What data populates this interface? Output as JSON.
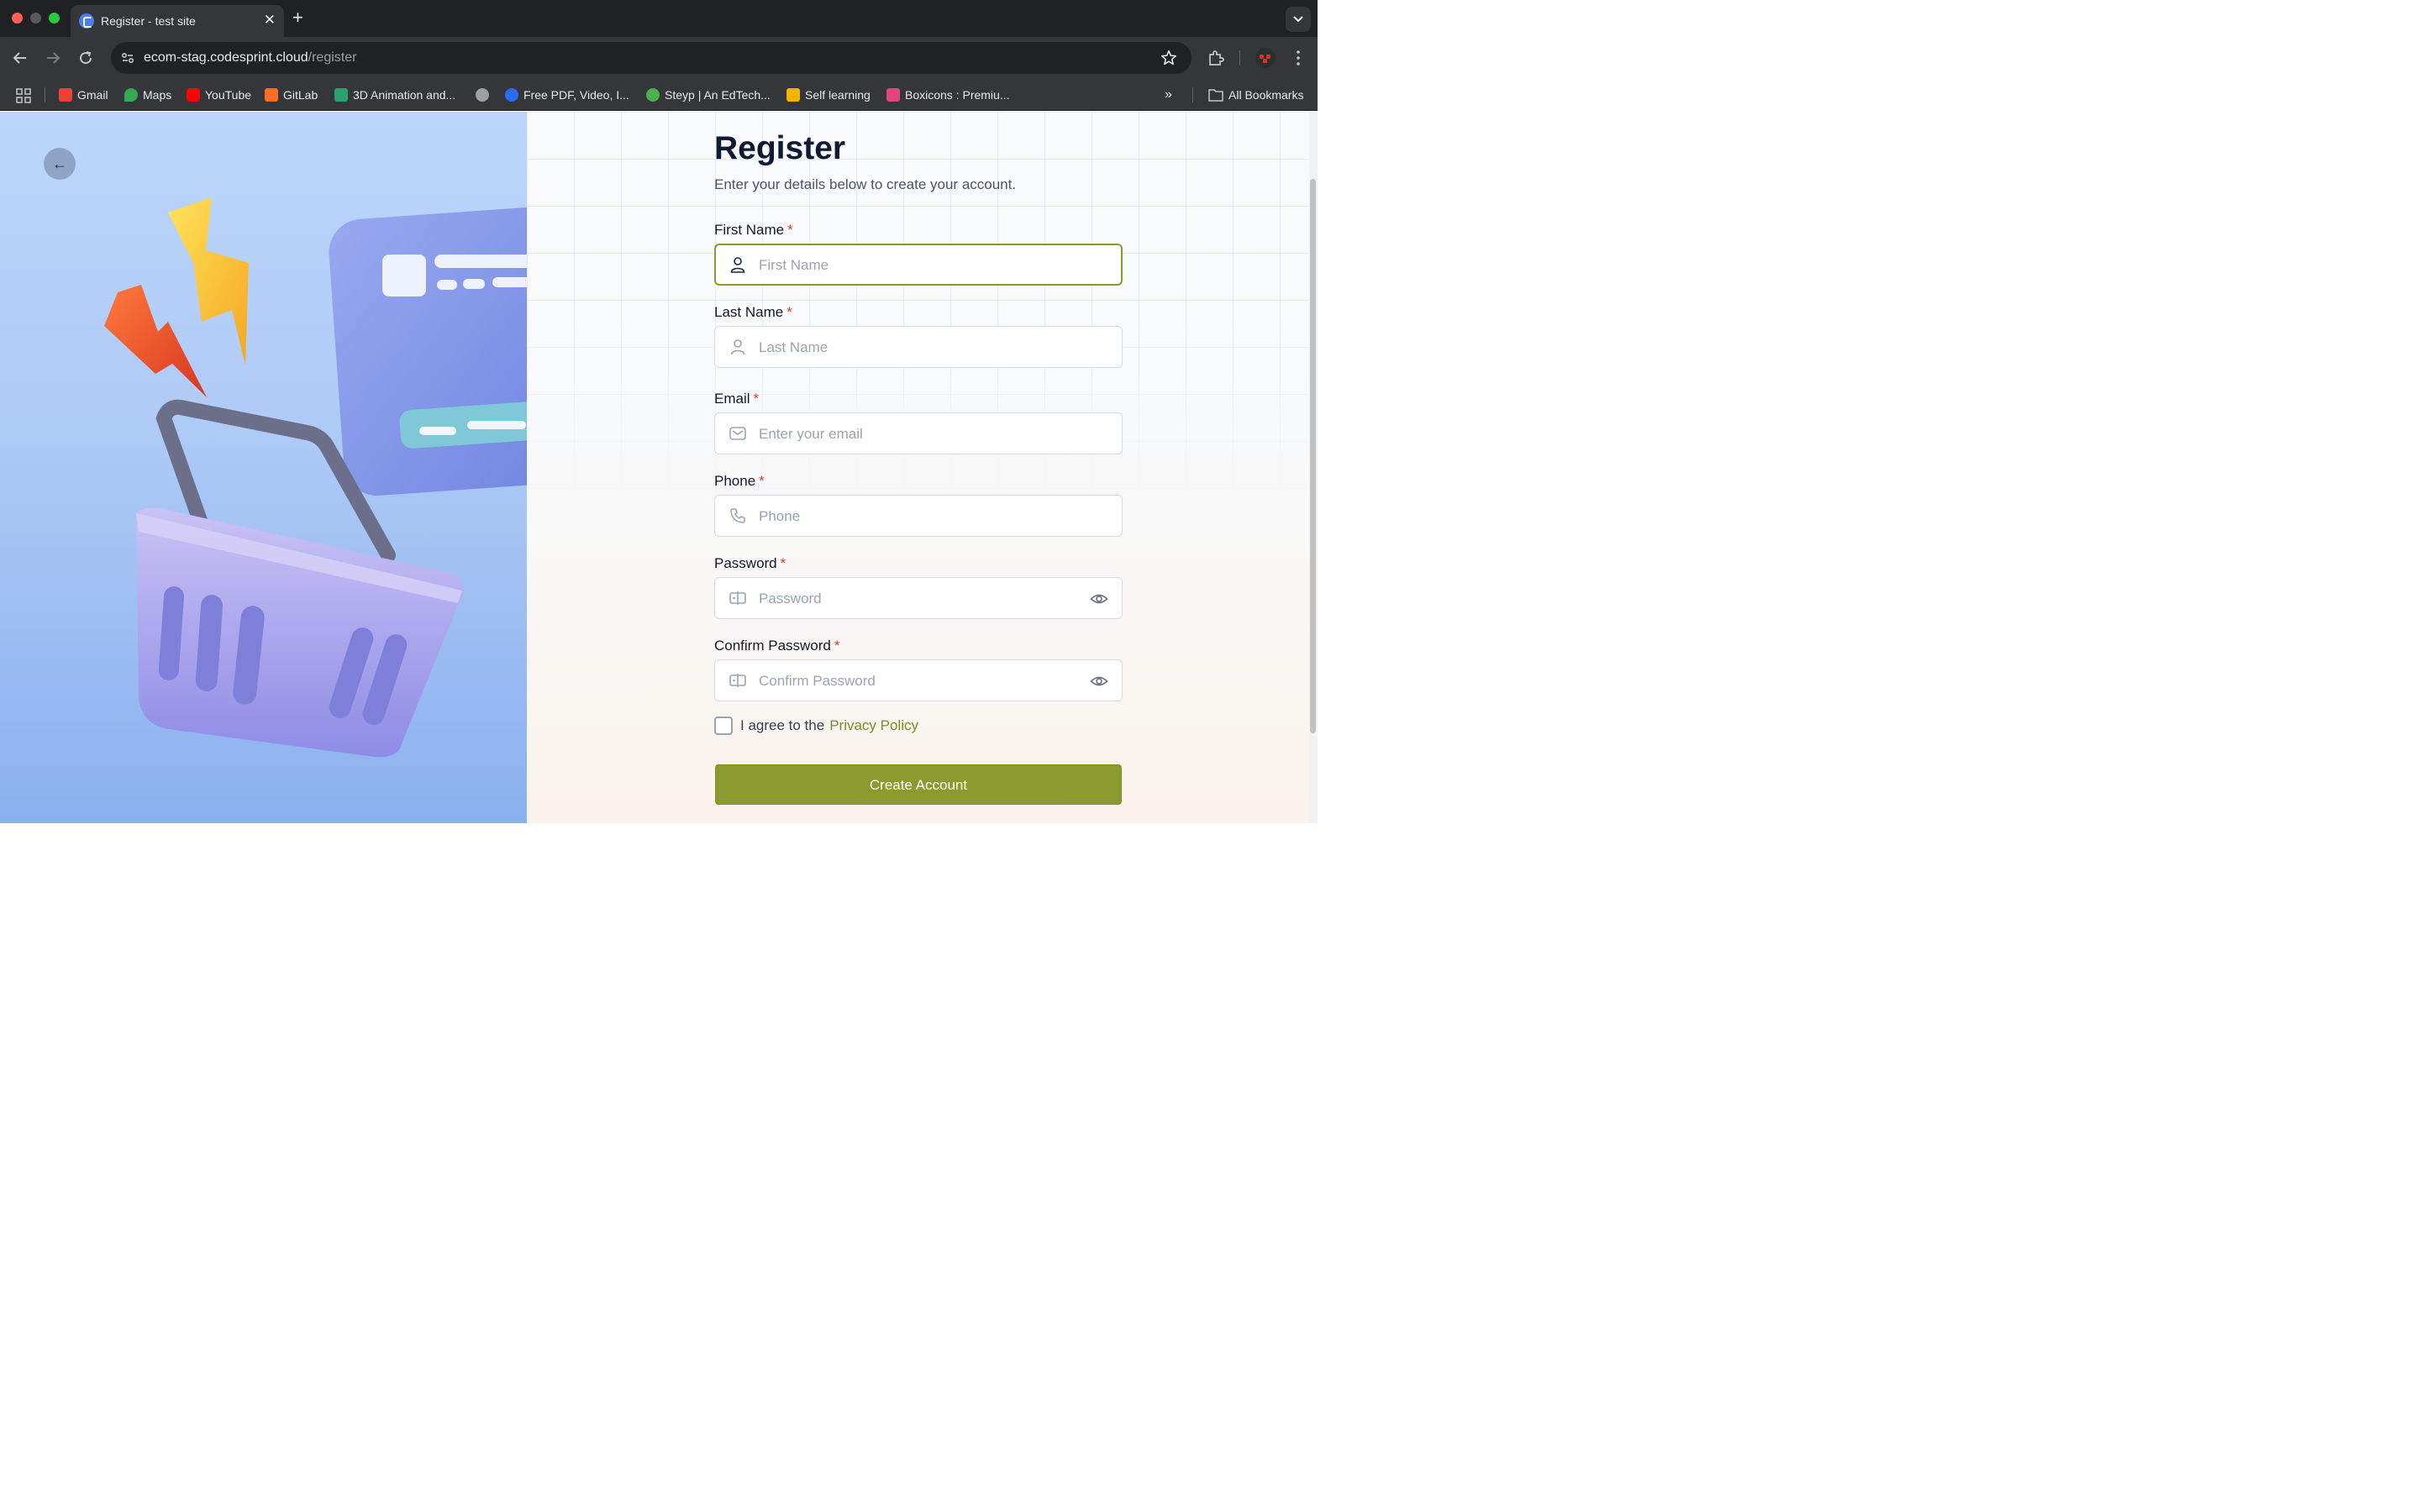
{
  "browser": {
    "tab_title": "Register - test site",
    "url_host": "ecom-stag.codesprint.cloud",
    "url_path": "/register",
    "bookmarks": [
      {
        "label": "Gmail",
        "icon": "gmail-icon",
        "color": "#ea4335"
      },
      {
        "label": "Maps",
        "icon": "maps-icon",
        "color": "#34a853"
      },
      {
        "label": "YouTube",
        "icon": "youtube-icon",
        "color": "#ff0000"
      },
      {
        "label": "GitLab",
        "icon": "gitlab-icon",
        "color": "#fc6d26"
      },
      {
        "label": "3D Animation and...",
        "icon": "animation-icon",
        "color": "#2aa36a"
      },
      {
        "label": "",
        "icon": "globe-icon",
        "color": "#9aa0a6"
      },
      {
        "label": "Free PDF, Video, I...",
        "icon": "pdf-tool-icon",
        "color": "#2b6cf6"
      },
      {
        "label": "Steyp | An EdTech...",
        "icon": "steyp-icon",
        "color": "#4caf50"
      },
      {
        "label": "Self learning",
        "icon": "self-learning-icon",
        "color": "#f4b400"
      },
      {
        "label": "Boxicons : Premiu...",
        "icon": "boxicons-icon",
        "color": "#e0457b"
      }
    ],
    "all_bookmarks": "All Bookmarks"
  },
  "page": {
    "title": "Register",
    "subtitle": "Enter your details below to create your account.",
    "fields": {
      "first_name": {
        "label": "First Name",
        "placeholder": "First Name"
      },
      "last_name": {
        "label": "Last Name",
        "placeholder": "Last Name"
      },
      "email": {
        "label": "Email",
        "placeholder": "Enter your email"
      },
      "phone": {
        "label": "Phone",
        "placeholder": "Phone"
      },
      "password": {
        "label": "Password",
        "placeholder": "Password"
      },
      "confirm_password": {
        "label": "Confirm Password",
        "placeholder": "Confirm Password"
      }
    },
    "required_mark": "*",
    "agree_text": "I agree to the",
    "privacy_link": "Privacy Policy",
    "submit_label": "Create Account",
    "colors": {
      "accent": "#8a9a2e",
      "required": "#e0342b"
    }
  }
}
